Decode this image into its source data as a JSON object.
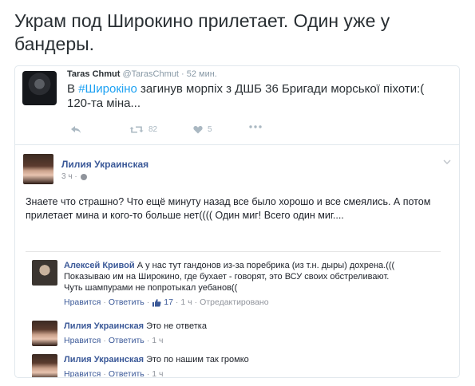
{
  "headline": "Укрaм под Широкино прилетает. Один уже у бандеры.",
  "tweet": {
    "author_name": "Taras Chmut",
    "handle": "@TarasChmut",
    "time": "· 52 мин.",
    "text_before": "В ",
    "hashtag": "#Широкіно",
    "text_after": " загинув морпіх з ДШБ 36 Бригади морської піхоти:( 120-та міна...",
    "retweets": "82",
    "likes": "5"
  },
  "post": {
    "author": "Лилия Украинская",
    "time": "3 ч ·",
    "text": "Знаете что страшно? Что ещё минуту назад все было хорошо и все смеялись. А потом прилетает мина и кого-то больше нет(((( Один миг! Всего один миг....",
    "comments": [
      {
        "author": "Алексей Кривой",
        "text": "А у нас тут гандонов из-за поребрика (из т.н. дыры) дохрена.((( Показываю им на Широкино, где бухает - говорят, это ВСУ своих обстреливают. Чуть шампурами не попротыкал уебанов((",
        "like": "Нравится",
        "reply": "Ответить",
        "likes_count": "17",
        "time": "1 ч",
        "edited": "Отредактировано"
      },
      {
        "author": "Лилия Украинская",
        "text": "Это не ответка",
        "like": "Нравится",
        "reply": "Ответить",
        "time": "1 ч"
      },
      {
        "author": "Лилия Украинская",
        "text": "Это по нашим так громко",
        "like": "Нравится",
        "reply": "Ответить",
        "time": "1 ч"
      }
    ]
  },
  "colors": {
    "fb_link": "#3b5998",
    "twitter_blue": "#1da1f2",
    "muted": "#90949c"
  }
}
